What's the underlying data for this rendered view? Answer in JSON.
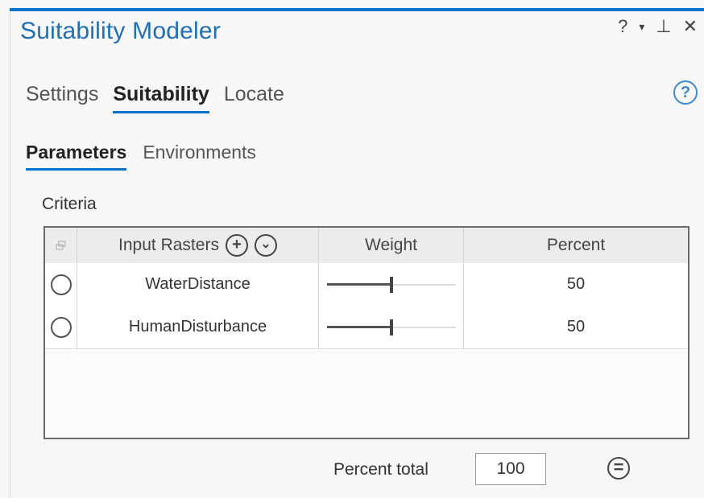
{
  "pane": {
    "title": "Suitability Modeler"
  },
  "window_controls": {
    "help": "?",
    "options": "▾",
    "pin": "⊥",
    "close": "✕"
  },
  "tabs": [
    {
      "label": "Settings",
      "active": false
    },
    {
      "label": "Suitability",
      "active": true
    },
    {
      "label": "Locate",
      "active": false
    }
  ],
  "subtabs": [
    {
      "label": "Parameters",
      "active": true
    },
    {
      "label": "Environments",
      "active": false
    }
  ],
  "help_button": "?",
  "criteria": {
    "label": "Criteria",
    "columns": {
      "input_rasters": "Input Rasters",
      "weight": "Weight",
      "percent": "Percent"
    },
    "add_button": "+",
    "menu_button": "⌄",
    "rows": [
      {
        "name": "WaterDistance",
        "weight": 0.5,
        "percent": "50"
      },
      {
        "name": "HumanDisturbance",
        "weight": 0.5,
        "percent": "50"
      }
    ]
  },
  "footer": {
    "percent_total_label": "Percent total",
    "percent_total_value": "100",
    "equalize_button": "="
  },
  "colors": {
    "accent": "#0b73c9",
    "title": "#1f6fb7"
  },
  "icons": [
    "help-icon",
    "dropdown-icon",
    "pin-icon",
    "close-icon",
    "add-icon",
    "chevron-down-icon",
    "equal-icon",
    "radio-icon",
    "layers-icon"
  ]
}
